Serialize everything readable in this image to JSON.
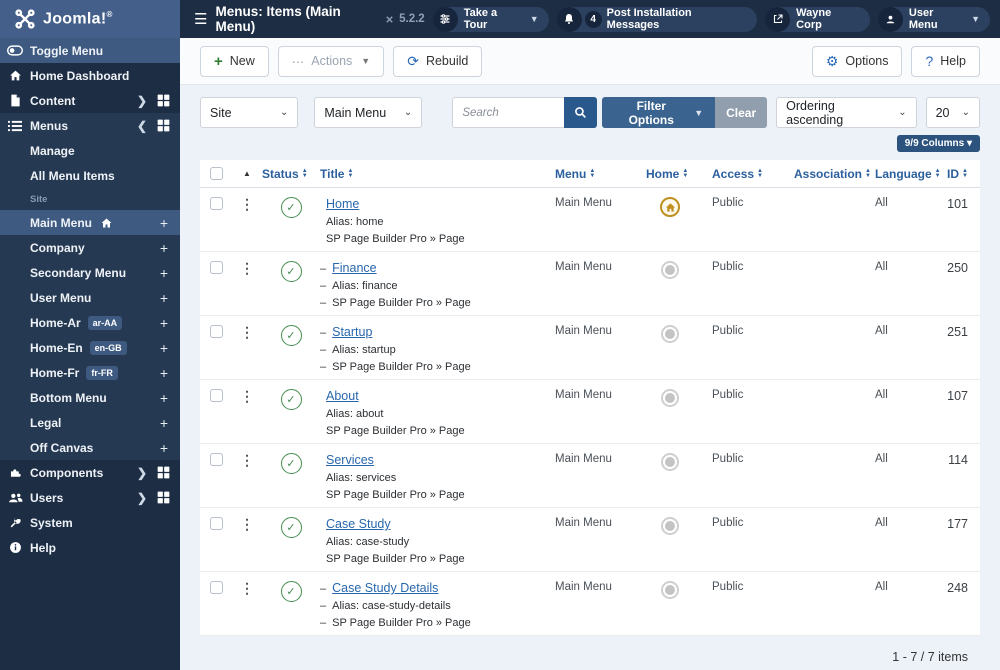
{
  "topbar": {
    "logo_text": "Joomla!",
    "title": "Menus: Items (Main Menu)",
    "version": "5.2.2",
    "take_a_tour": "Take a Tour",
    "messages_badge": "4",
    "messages_label": "Post Installation Messages",
    "site_name": "Wayne Corp",
    "user_menu": "User Menu"
  },
  "sidebar": {
    "toggle": "Toggle Menu",
    "home_dashboard": "Home Dashboard",
    "content": "Content",
    "menus": "Menus",
    "manage": "Manage",
    "all_menu_items": "All Menu Items",
    "site_label": "Site",
    "menu_list": [
      {
        "label": "Main Menu",
        "active": true
      },
      {
        "label": "Company"
      },
      {
        "label": "Secondary Menu"
      },
      {
        "label": "User Menu"
      },
      {
        "label": "Home-Ar",
        "badge": "ar-AA"
      },
      {
        "label": "Home-En",
        "badge": "en-GB"
      },
      {
        "label": "Home-Fr",
        "badge": "fr-FR"
      },
      {
        "label": "Bottom Menu"
      },
      {
        "label": "Legal"
      },
      {
        "label": "Off Canvas"
      }
    ],
    "components": "Components",
    "users": "Users",
    "system": "System",
    "help": "Help"
  },
  "toolbar": {
    "new": "New",
    "actions": "Actions",
    "rebuild": "Rebuild",
    "options": "Options",
    "help": "Help"
  },
  "filters": {
    "site_select": "Site",
    "menu_select": "Main Menu",
    "search_placeholder": "Search",
    "filter_options": "Filter Options",
    "clear": "Clear",
    "ordering": "Ordering ascending",
    "limit": "20",
    "columns": "9/9 Columns ▾"
  },
  "table": {
    "headers": [
      "Status",
      "Title",
      "Menu",
      "Home",
      "Access",
      "Association",
      "Language",
      "ID"
    ],
    "alias_prefix": "Alias: ",
    "rows": [
      {
        "title": "Home",
        "alias": "home",
        "type": "SP Page Builder Pro » Page",
        "menu": "Main Menu",
        "home": true,
        "access": "Public",
        "language": "All",
        "id": "101",
        "level": 1
      },
      {
        "title": "Finance",
        "alias": "finance",
        "type": "SP Page Builder Pro » Page",
        "menu": "Main Menu",
        "home": false,
        "access": "Public",
        "language": "All",
        "id": "250",
        "level": 2
      },
      {
        "title": "Startup",
        "alias": "startup",
        "type": "SP Page Builder Pro » Page",
        "menu": "Main Menu",
        "home": false,
        "access": "Public",
        "language": "All",
        "id": "251",
        "level": 2
      },
      {
        "title": "About",
        "alias": "about",
        "type": "SP Page Builder Pro » Page",
        "menu": "Main Menu",
        "home": false,
        "access": "Public",
        "language": "All",
        "id": "107",
        "level": 1
      },
      {
        "title": "Services",
        "alias": "services",
        "type": "SP Page Builder Pro » Page",
        "menu": "Main Menu",
        "home": false,
        "access": "Public",
        "language": "All",
        "id": "114",
        "level": 1
      },
      {
        "title": "Case Study",
        "alias": "case-study",
        "type": "SP Page Builder Pro » Page",
        "menu": "Main Menu",
        "home": false,
        "access": "Public",
        "language": "All",
        "id": "177",
        "level": 1
      },
      {
        "title": "Case Study Details",
        "alias": "case-study-details",
        "type": "SP Page Builder Pro » Page",
        "menu": "Main Menu",
        "home": false,
        "access": "Public",
        "language": "All",
        "id": "248",
        "level": 2
      }
    ]
  },
  "footer": {
    "count": "1 - 7 / 7 items"
  },
  "icons": {
    "plus": "+",
    "chevron_down": "⌄",
    "chevron_right": "›",
    "dots_v": "⋮",
    "dots_h": "⋯",
    "sort_up": "▲",
    "sort_down": "▼",
    "check": "✓",
    "gear": "⚙",
    "question": "?",
    "refresh": "⟳",
    "menus_list": "☰"
  },
  "colors": {
    "topbar": "#1d2d43",
    "accent_blue": "#3e5a80",
    "link": "#2867ac",
    "green": "#448d4f",
    "gold": "#c0901e",
    "filter_btn": "#3a648f",
    "clear_btn": "#919eae"
  }
}
